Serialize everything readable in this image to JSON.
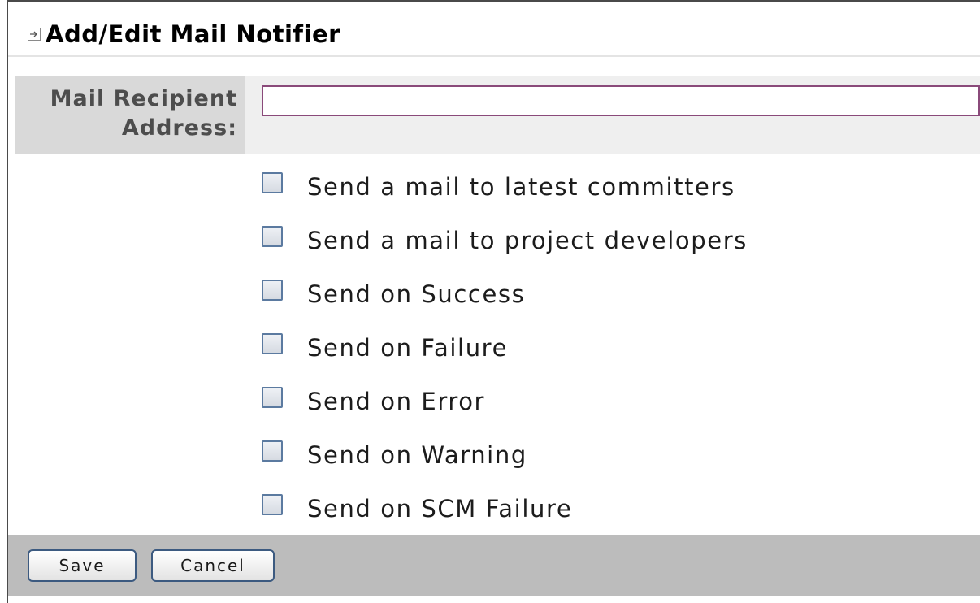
{
  "header": {
    "title": "Add/Edit Mail Notifier",
    "icon": "expand-arrow-icon"
  },
  "form": {
    "recipient_label": "Mail Recipient Address:",
    "recipient_value": "",
    "recipient_placeholder": "",
    "checkboxes": [
      {
        "label": "Send a mail to latest committers",
        "checked": false
      },
      {
        "label": "Send a mail to project developers",
        "checked": false
      },
      {
        "label": "Send on Success",
        "checked": false
      },
      {
        "label": "Send on Failure",
        "checked": false
      },
      {
        "label": "Send on Error",
        "checked": false
      },
      {
        "label": "Send on Warning",
        "checked": false
      },
      {
        "label": "Send on SCM Failure",
        "checked": false
      }
    ]
  },
  "footer": {
    "save_label": "Save",
    "cancel_label": "Cancel"
  },
  "colors": {
    "input_border": "#8a4a7a",
    "checkbox_border": "#5b7aa0",
    "button_border": "#3c5a80",
    "footer_bg": "#bcbcbc",
    "label_bg": "#d9d9d9"
  }
}
